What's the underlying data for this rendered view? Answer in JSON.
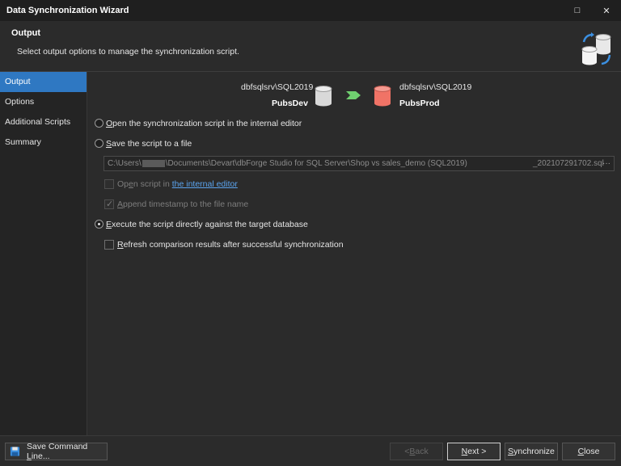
{
  "window": {
    "title": "Data Synchronization Wizard",
    "minimize_glyph": "□",
    "close_glyph": "✕"
  },
  "header": {
    "title": "Output",
    "subtitle": "Select output options to manage the synchronization script.",
    "icon": "database-sync-icon"
  },
  "sidebar": {
    "items": [
      {
        "label": "Output"
      },
      {
        "label": "Options"
      },
      {
        "label": "Additional Scripts"
      },
      {
        "label": "Summary"
      }
    ]
  },
  "connection": {
    "source": {
      "server": "dbfsqlsrv\\SQL2019",
      "database": "PubsDev"
    },
    "target": {
      "server": "dbfsqlsrv\\SQL2019",
      "database": "PubsProd"
    }
  },
  "options": {
    "open_editor": {
      "label_u": "O",
      "label_rest": "pen the synchronization script in the internal editor"
    },
    "save_file": {
      "label_u": "S",
      "label_rest": "ave the script to a file"
    },
    "path": {
      "start": "C:\\Users\\",
      "middle": "\\Documents\\Devart\\dbForge Studio for SQL Server\\Shop vs sales_demo (SQL2019)",
      "end": "_202107291702.sql",
      "browse": "···"
    },
    "open_in": {
      "pre": "Op",
      "u": "e",
      "post": "n script in ",
      "link": "the internal editor"
    },
    "append": {
      "u": "A",
      "rest": "ppend timestamp to the file name"
    },
    "execute": {
      "u": "E",
      "rest": "xecute the script directly against the target database"
    },
    "refresh": {
      "u": "R",
      "rest": "efresh comparison results after successful synchronization"
    }
  },
  "footer": {
    "save_cmd": {
      "pre": "Save Command ",
      "u": "L",
      "post": "ine..."
    },
    "back": {
      "pre": "< ",
      "u": "B",
      "post": "ack"
    },
    "next": {
      "u": "N",
      "post": "ext >"
    },
    "sync": {
      "u": "S",
      "post": "ynchronize"
    },
    "close": {
      "u": "C",
      "post": "lose"
    }
  },
  "colors": {
    "accent": "#2f78c2",
    "source_db": "#d9d9d9",
    "target_db": "#f07366",
    "arrow": "#6fcf6f"
  }
}
